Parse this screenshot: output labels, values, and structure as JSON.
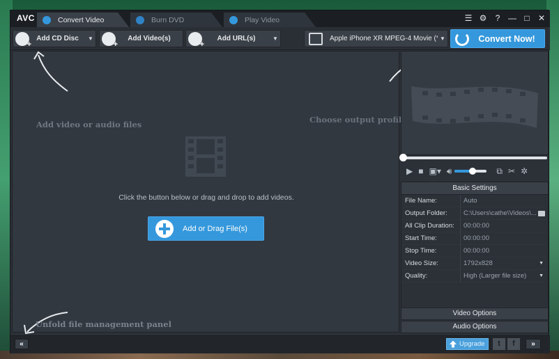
{
  "app": {
    "logo": "AVC"
  },
  "tabs": [
    {
      "label": "Convert Video",
      "icon": "convert-icon",
      "active": true
    },
    {
      "label": "Burn DVD",
      "icon": "disc-icon",
      "active": false
    },
    {
      "label": "Play Video",
      "icon": "play-icon",
      "active": false
    }
  ],
  "window_controls": {
    "menu": "☰",
    "settings": "⚙",
    "help": "?",
    "minimize": "—",
    "maximize": "□",
    "close": "✕"
  },
  "toolbar": {
    "add_cd_disc": "Add CD Disc",
    "add_videos": "Add Video(s)",
    "add_url": "Add URL(s)",
    "profile": "Apple iPhone XR MPEG-4 Movie (*.m...",
    "convert_now": "Convert Now!"
  },
  "hints": {
    "add_files": "Add video or audio files",
    "choose_profile": "Choose output profile and convert",
    "unfold_panel": "Unfold file management panel"
  },
  "droparea": {
    "instruction": "Click the button below or drag and drop to add videos.",
    "add_button": "Add or Drag File(s)"
  },
  "player": {
    "seek_position": 0.0,
    "volume": 0.55
  },
  "basic_settings": {
    "title": "Basic Settings",
    "rows": [
      {
        "key": "File Name:",
        "value": "Auto",
        "dropdown": false
      },
      {
        "key": "Output Folder:",
        "value": "C:\\Users\\cathe\\Videos\\...",
        "dropdown": false,
        "folder": true
      },
      {
        "key": "All Clip Duration:",
        "value": "00:00:00",
        "dropdown": false
      },
      {
        "key": "Start Time:",
        "value": "00:00:00",
        "dropdown": false
      },
      {
        "key": "Stop Time:",
        "value": "00:00:00",
        "dropdown": false
      },
      {
        "key": "Video Size:",
        "value": "1792x828",
        "dropdown": true
      },
      {
        "key": "Quality:",
        "value": "High (Larger file size)",
        "dropdown": true
      }
    ]
  },
  "options": {
    "video": "Video Options",
    "audio": "Audio Options"
  },
  "bottom": {
    "collapse": "«",
    "upgrade": "Upgrade",
    "twitter": "t",
    "facebook": "f",
    "expand": "»"
  },
  "colors": {
    "accent": "#3598dc",
    "panel": "#2c3138",
    "titlebar": "#1b1f24"
  }
}
